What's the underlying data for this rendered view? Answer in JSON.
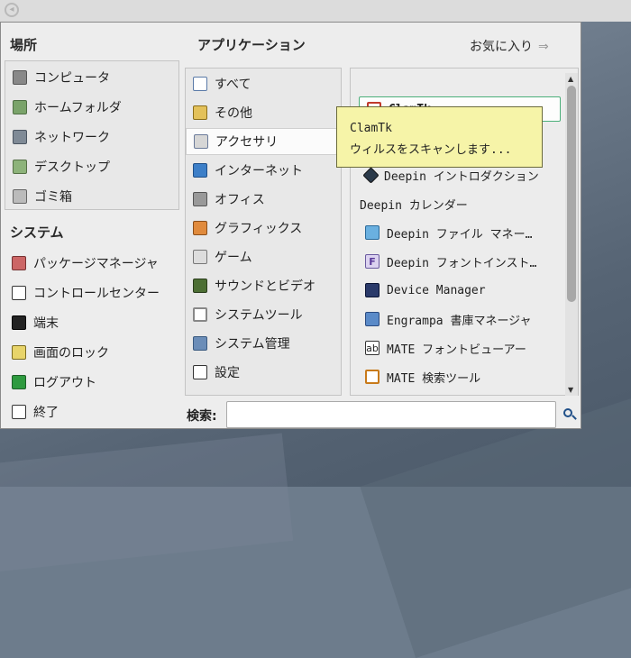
{
  "places": {
    "title": "場所",
    "items": [
      {
        "label": "コンピュータ",
        "icon": "computer-icon"
      },
      {
        "label": "ホームフォルダ",
        "icon": "home-folder-icon"
      },
      {
        "label": "ネットワーク",
        "icon": "network-icon"
      },
      {
        "label": "デスクトップ",
        "icon": "desktop-folder-icon"
      },
      {
        "label": "ゴミ箱",
        "icon": "trash-icon"
      }
    ]
  },
  "system": {
    "title": "システム",
    "items": [
      {
        "label": "パッケージマネージャ",
        "icon": "package-manager-icon"
      },
      {
        "label": "コントロールセンター",
        "icon": "control-center-icon"
      },
      {
        "label": "端末",
        "icon": "terminal-icon"
      },
      {
        "label": "画面のロック",
        "icon": "lock-screen-icon"
      },
      {
        "label": "ログアウト",
        "icon": "logout-icon"
      },
      {
        "label": "終了",
        "icon": "shutdown-icon"
      }
    ]
  },
  "applications": {
    "title": "アプリケーション",
    "favorites_label": "お気に入り",
    "categories": [
      {
        "label": "すべて",
        "icon": "all-apps-icon"
      },
      {
        "label": "その他",
        "icon": "other-icon"
      },
      {
        "label": "アクセサリ",
        "icon": "accessories-icon",
        "selected": true
      },
      {
        "label": "インターネット",
        "icon": "internet-icon"
      },
      {
        "label": "オフィス",
        "icon": "office-icon"
      },
      {
        "label": "グラフィックス",
        "icon": "graphics-icon"
      },
      {
        "label": "ゲーム",
        "icon": "games-icon"
      },
      {
        "label": "サウンドとビデオ",
        "icon": "sound-video-icon"
      },
      {
        "label": "システムツール",
        "icon": "system-tools-icon"
      },
      {
        "label": "システム管理",
        "icon": "system-admin-icon"
      },
      {
        "label": "設定",
        "icon": "settings-icon"
      }
    ],
    "apps": [
      {
        "label": "ClamTk",
        "icon": "clamtk-icon",
        "selected": true
      },
      {
        "label": "Deepin イントロダクション",
        "icon": "deepin-intro-icon"
      },
      {
        "label": "Deepin カレンダー",
        "icon": ""
      },
      {
        "label": "Deepin ファイル マネー…",
        "icon": "deepin-file-manager-icon"
      },
      {
        "label": "Deepin フォントインスト…",
        "icon": "deepin-font-installer-icon"
      },
      {
        "label": "Device Manager",
        "icon": "device-manager-icon"
      },
      {
        "label": "Engrampa 書庫マネージャ",
        "icon": "engrampa-icon"
      },
      {
        "label": "MATE フォントビューアー",
        "icon": "mate-font-viewer-icon"
      },
      {
        "label": "MATE 検索ツール",
        "icon": "mate-search-tool-icon"
      }
    ]
  },
  "tooltip": {
    "title": "ClamTk",
    "description": "ウィルスをスキャンします..."
  },
  "search": {
    "label": "検索:",
    "value": ""
  }
}
